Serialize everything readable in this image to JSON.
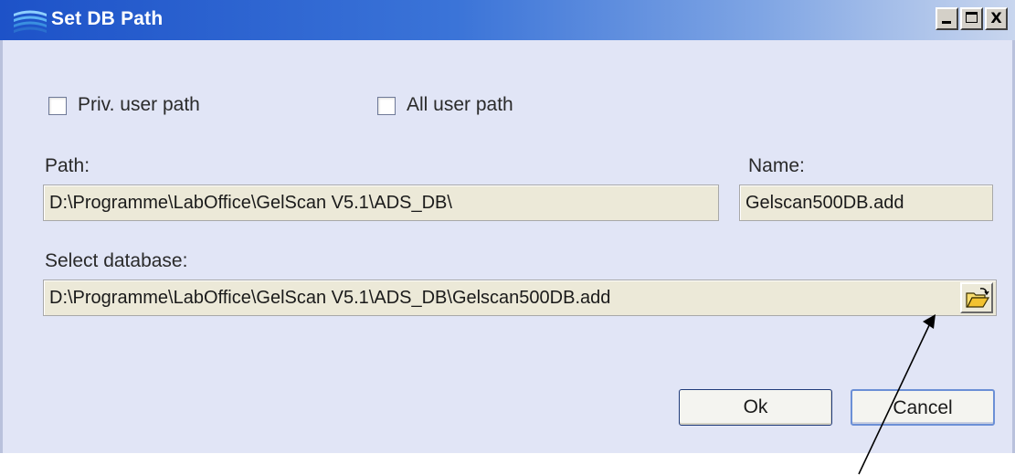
{
  "window": {
    "title": "Set DB Path",
    "controls": {
      "minimize_icon": "minimize-icon",
      "maximize_icon": "maximize-icon",
      "close_label": "X"
    }
  },
  "options": {
    "priv_user_path": {
      "label": "Priv. user path",
      "checked": false
    },
    "all_user_path": {
      "label": "All user path",
      "checked": false
    }
  },
  "path": {
    "label": "Path:",
    "value": "D:\\Programme\\LabOffice\\GelScan V5.1\\ADS_DB\\"
  },
  "name": {
    "label": "Name:",
    "value": "Gelscan500DB.add"
  },
  "select_database": {
    "label": "Select database:",
    "value": "D:\\Programme\\LabOffice\\GelScan V5.1\\ADS_DB\\Gelscan500DB.add",
    "browse_icon": "open-folder-icon"
  },
  "buttons": {
    "ok_label": "Ok",
    "cancel_label": "Cancel"
  },
  "colors": {
    "titlebar_start": "#1d52c8",
    "client_background": "#e1e5f6",
    "field_background": "#ece9d8"
  }
}
